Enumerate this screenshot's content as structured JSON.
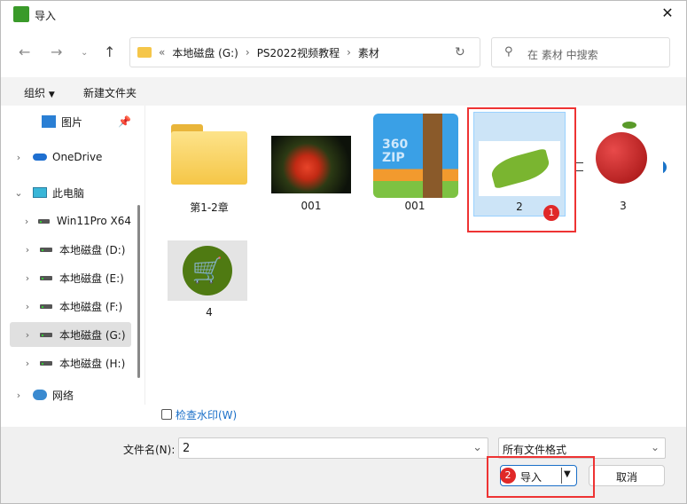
{
  "window": {
    "title": "导入"
  },
  "address": {
    "overflow": "«",
    "crumbs": [
      "本地磁盘 (G:)",
      "PS2022视频教程",
      "素材"
    ]
  },
  "search": {
    "placeholder": "在 素材 中搜索"
  },
  "toolbar": {
    "organize": "组织",
    "new_folder": "新建文件夹",
    "help": "?"
  },
  "sidebar": {
    "items": [
      {
        "label": "图片"
      },
      {
        "label": "OneDrive"
      },
      {
        "label": "此电脑"
      },
      {
        "label": "Win11Pro X64"
      },
      {
        "label": "本地磁盘 (D:)"
      },
      {
        "label": "本地磁盘 (E:)"
      },
      {
        "label": "本地磁盘 (F:)"
      },
      {
        "label": "本地磁盘 (G:)"
      },
      {
        "label": "本地磁盘 (H:)"
      },
      {
        "label": "网络"
      }
    ]
  },
  "files": [
    {
      "name": "第1-2章",
      "type": "folder"
    },
    {
      "name": "001",
      "type": "image-tulip"
    },
    {
      "name": "001",
      "type": "zip",
      "zip_text": "360 ZIP"
    },
    {
      "name": "2",
      "type": "image-leaf",
      "selected": true
    },
    {
      "name": "3",
      "type": "image-apple"
    },
    {
      "name": "4",
      "type": "image-cart"
    }
  ],
  "watermark_check": {
    "label": "检查水印(W)",
    "checked": false
  },
  "filename": {
    "label": "文件名(N):",
    "value": "2"
  },
  "filetype": {
    "value": "所有文件格式"
  },
  "buttons": {
    "import": "导入",
    "cancel": "取消"
  },
  "annotations": {
    "step1": "1",
    "step2": "2",
    "color": "#e33333"
  }
}
